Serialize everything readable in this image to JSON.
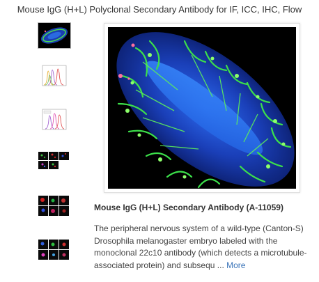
{
  "header": {
    "title": "Mouse IgG (H+L) Polyclonal Secondary Antibody for IF, ICC, IHC, Flow"
  },
  "gallery": {
    "selected_index": 0,
    "thumbnails": [
      {
        "icon": "embryo-fluorescence-thumbnail"
      },
      {
        "icon": "flow-histogram-thumbnail"
      },
      {
        "icon": "flow-histogram-thumbnail"
      },
      {
        "icon": "cell-panel-grid-thumbnail"
      },
      {
        "icon": "cell-panel-grid-thumbnail"
      },
      {
        "icon": "cell-panel-grid-thumbnail"
      }
    ]
  },
  "caption": {
    "title": "Mouse IgG (H+L) Secondary Antibody (A-11059)",
    "description": "The peripheral nervous system of a wild-type (Canton-S) Drosophila melanogaster embryo labeled with the monoclonal 22c10 antibody (which detects a microtubule-associated protein) and subsequ ...",
    "more_label": "More"
  },
  "colors": {
    "link": "#3a74b9",
    "text": "#333333",
    "image_background": "#000000"
  }
}
